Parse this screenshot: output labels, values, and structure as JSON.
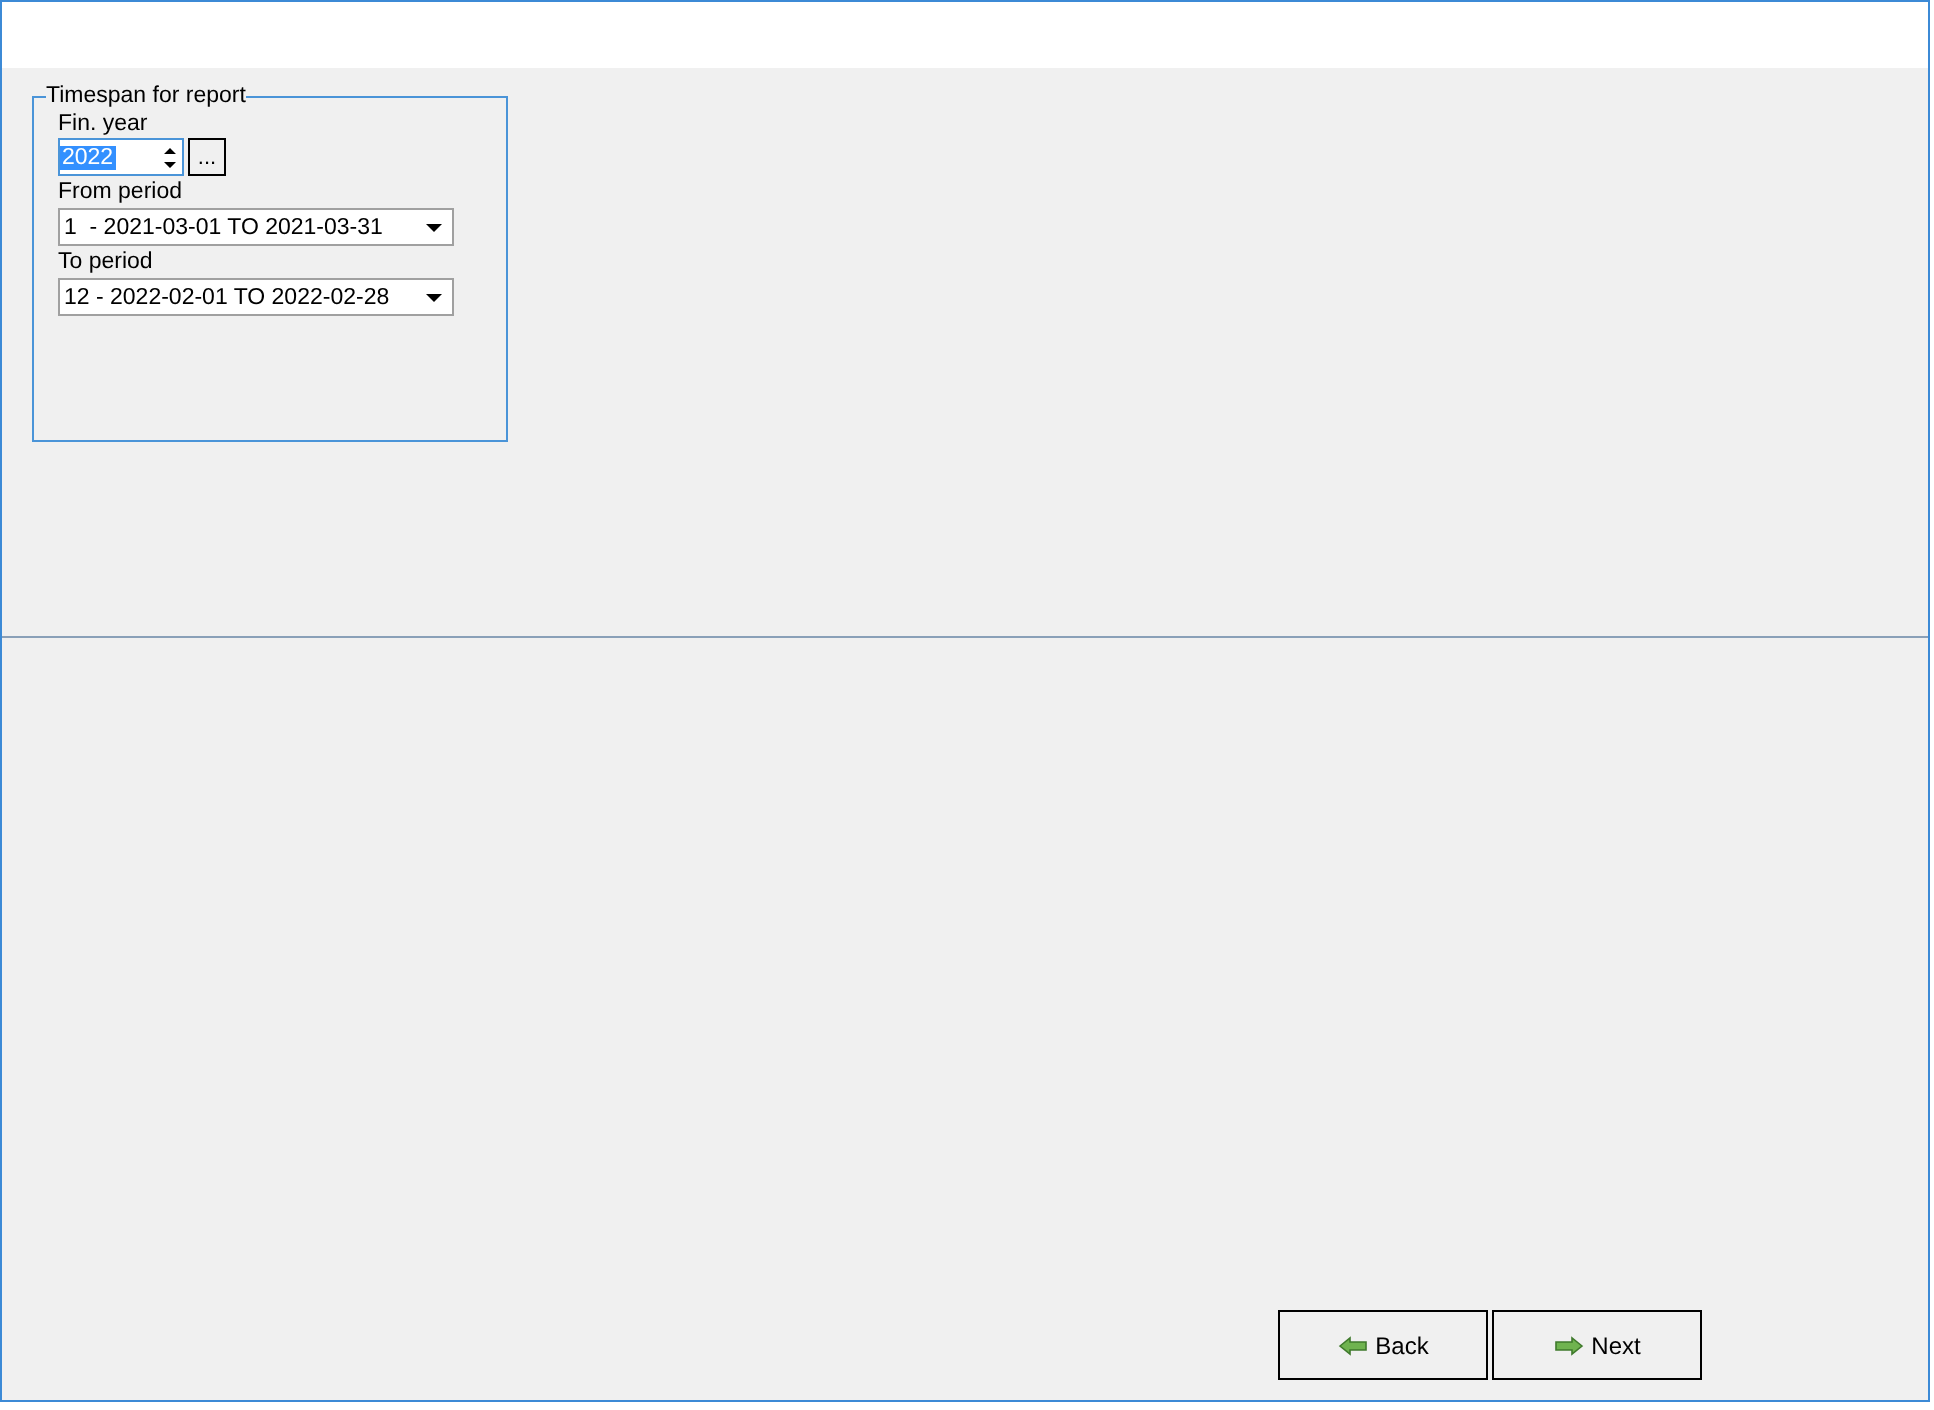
{
  "group": {
    "title": "Timespan for report",
    "fin_year": {
      "label": "Fin. year",
      "value": "2022",
      "text_selected": true,
      "browse_button": "..."
    },
    "from_period": {
      "label": "From period",
      "value": "1  - 2021-03-01 TO 2021-03-31"
    },
    "to_period": {
      "label": "To period",
      "value": "12 - 2022-02-01 TO 2022-02-28"
    }
  },
  "buttons": [
    {
      "label": "Back",
      "kind": "back"
    },
    {
      "label": "Next",
      "kind": "next"
    }
  ]
}
